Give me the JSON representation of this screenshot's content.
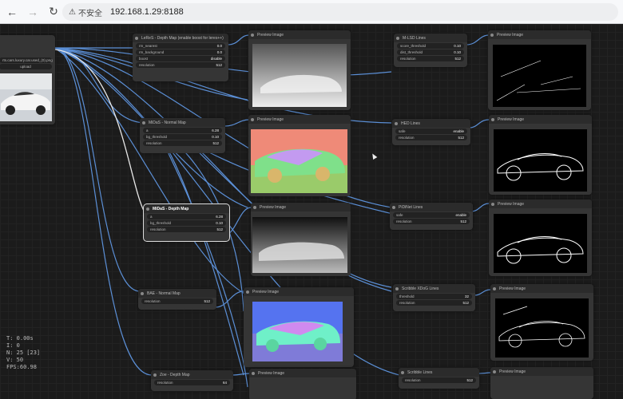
{
  "browser": {
    "warning_label": "不安全",
    "url": "192.168.1.29:8188"
  },
  "nodes": {
    "load_image": {
      "filename": "rts.cars.luxury.car.used_(0).png",
      "upload_label": "upload"
    },
    "leres": {
      "title": "LeReS - Depth Map (enable boost for leres++)",
      "widgets": [
        {
          "label": "rm_nearest",
          "value": "0.0"
        },
        {
          "label": "rm_background",
          "value": "0.0"
        },
        {
          "label": "boost",
          "value": "disable"
        },
        {
          "label": "resolution",
          "value": "512"
        }
      ]
    },
    "midas_normal": {
      "title": "MiDaS - Normal Map",
      "widgets": [
        {
          "label": "a",
          "value": "6.28"
        },
        {
          "label": "bg_threshold",
          "value": "0.10"
        },
        {
          "label": "resolution",
          "value": "512"
        }
      ]
    },
    "midas_depth": {
      "title": "MiDaS - Depth Map",
      "widgets": [
        {
          "label": "a",
          "value": "6.28"
        },
        {
          "label": "bg_threshold",
          "value": "0.10"
        },
        {
          "label": "resolution",
          "value": "512"
        }
      ]
    },
    "bae_normal": {
      "title": "BAE - Normal Map",
      "widgets": [
        {
          "label": "resolution",
          "value": "512"
        }
      ]
    },
    "zoe_depth": {
      "title": "Zoe - Depth Map",
      "widgets": [
        {
          "label": "resolution",
          "value": "64"
        }
      ]
    },
    "mlsd": {
      "title": "M-LSD Lines",
      "widgets": [
        {
          "label": "score_threshold",
          "value": "0.10"
        },
        {
          "label": "dist_threshold",
          "value": "0.10"
        },
        {
          "label": "resolution",
          "value": "512"
        }
      ]
    },
    "hed": {
      "title": "HED Lines",
      "widgets": [
        {
          "label": "safe",
          "value": "enable"
        },
        {
          "label": "resolution",
          "value": "512"
        }
      ]
    },
    "pidinet": {
      "title": "PiDiNet Lines",
      "widgets": [
        {
          "label": "safe",
          "value": "enable"
        },
        {
          "label": "resolution",
          "value": "512"
        }
      ]
    },
    "scribble_xdog": {
      "title": "Scribble XDoG Lines",
      "widgets": [
        {
          "label": "threshold",
          "value": "32"
        },
        {
          "label": "resolution",
          "value": "512"
        }
      ]
    },
    "scribble": {
      "title": "Scribble Lines",
      "widgets": [
        {
          "label": "resolution",
          "value": "512"
        }
      ]
    },
    "preview_title": "Preview Image"
  },
  "stats": {
    "t": "T: 0.00s",
    "i": "I: 0",
    "n": "N: 25 [23]",
    "v": "V: 50",
    "fps": "FPS:60.98"
  },
  "colors": {
    "wire": "#5b8fd6",
    "wire_selected": "#e8e8e8",
    "node_bg": "#353535",
    "canvas_bg": "#1b1b1b"
  }
}
